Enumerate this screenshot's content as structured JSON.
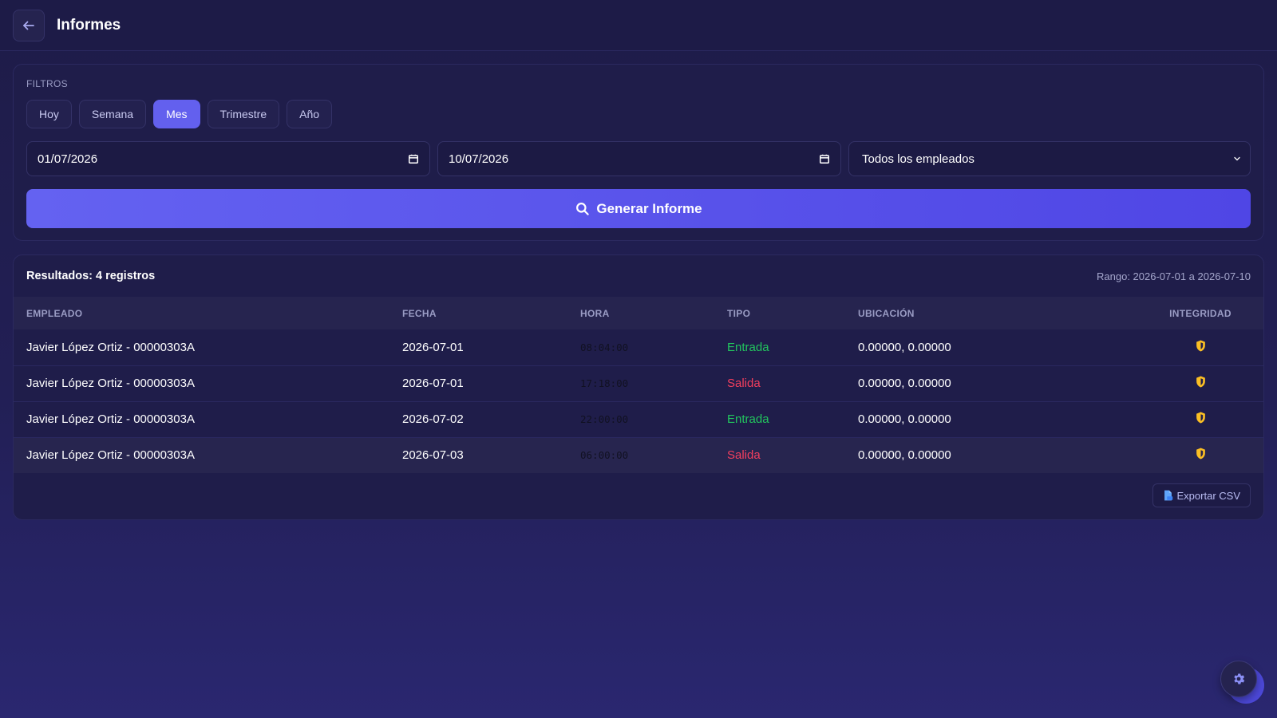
{
  "header": {
    "title": "Informes"
  },
  "filters": {
    "label": "FILTROS",
    "chips": [
      "Hoy",
      "Semana",
      "Mes",
      "Trimestre",
      "Año"
    ],
    "active_chip": "Mes",
    "date_from": "01/07/2026",
    "date_to": "10/07/2026",
    "employee_select": "Todos los empleados",
    "generate_label": "Generar Informe"
  },
  "results": {
    "title": "Resultados: 4 registros",
    "range": "Rango: 2026-07-01 a 2026-07-10",
    "columns": {
      "employee": "EMPLEADO",
      "date": "FECHA",
      "time": "HORA",
      "type": "TIPO",
      "location": "UBICACIÓN",
      "integrity": "INTEGRIDAD"
    },
    "rows": [
      {
        "employee": "Javier López Ortiz - 00000303A",
        "date": "2026-07-01",
        "time": "08:04:00",
        "type": "Entrada",
        "location": "0.00000, 0.00000",
        "integrity_icon": "shield-icon"
      },
      {
        "employee": "Javier López Ortiz - 00000303A",
        "date": "2026-07-01",
        "time": "17:18:00",
        "type": "Salida",
        "location": "0.00000, 0.00000",
        "integrity_icon": "shield-icon"
      },
      {
        "employee": "Javier López Ortiz - 00000303A",
        "date": "2026-07-02",
        "time": "22:00:00",
        "type": "Entrada",
        "location": "0.00000, 0.00000",
        "integrity_icon": "shield-icon"
      },
      {
        "employee": "Javier López Ortiz - 00000303A",
        "date": "2026-07-03",
        "time": "06:00:00",
        "type": "Salida",
        "location": "0.00000, 0.00000",
        "integrity_icon": "shield-icon"
      }
    ],
    "export_label": "Exportar CSV"
  },
  "colors": {
    "accent": "#6360ee",
    "entrada": "#22c55e",
    "salida": "#f43f5e",
    "shield": "#fbbf24"
  }
}
